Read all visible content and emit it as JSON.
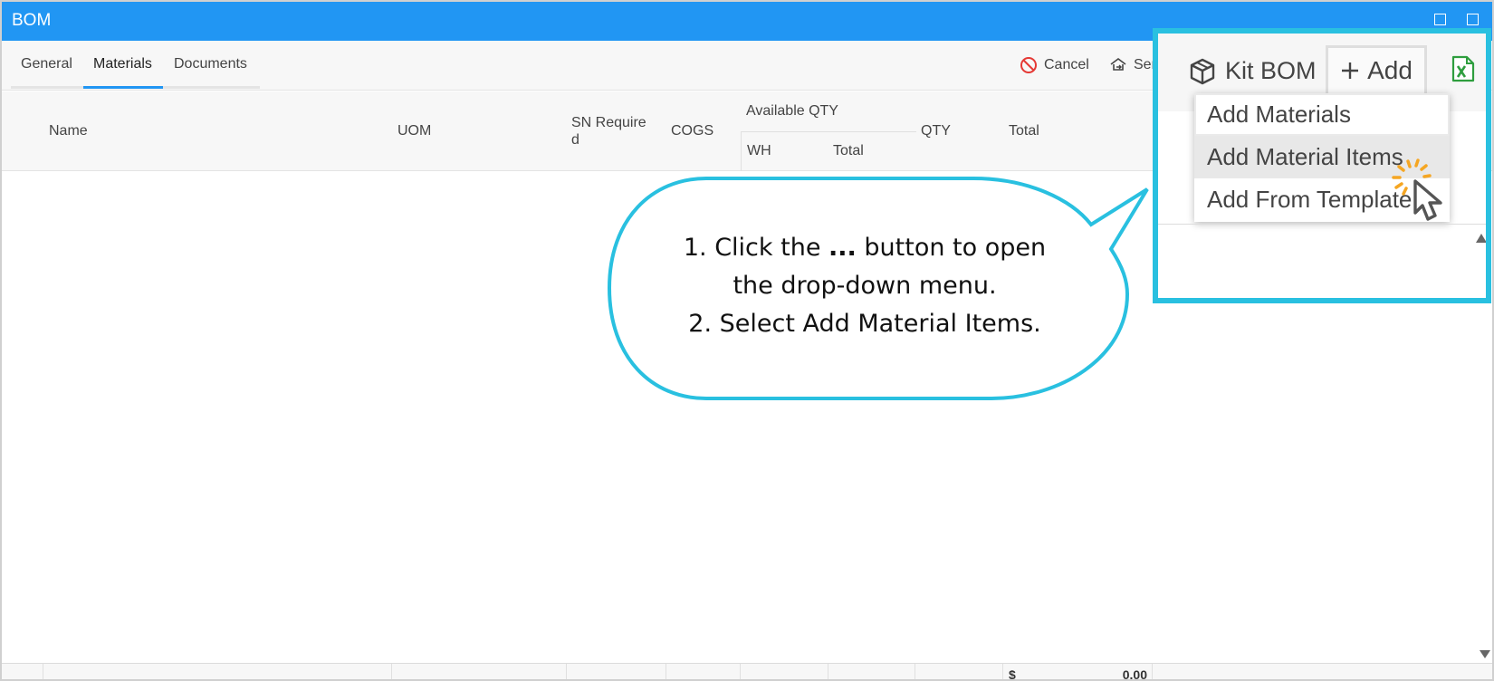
{
  "window": {
    "title": "BOM"
  },
  "tabs": [
    {
      "label": "General"
    },
    {
      "label": "Materials",
      "active": true
    },
    {
      "label": "Documents"
    }
  ],
  "toolbar": {
    "cancel_label": "Cancel",
    "send_label": "Sen"
  },
  "columns": {
    "name": "Name",
    "uom": "UOM",
    "sn_required_line1": "SN Require",
    "sn_required_line2": "d",
    "cogs": "COGS",
    "available_qty": "Available QTY",
    "wh": "WH",
    "avail_total": "Total",
    "qty": "QTY",
    "total": "Total"
  },
  "footer": {
    "currency": "$",
    "total_value": "0.00"
  },
  "callout": {
    "line1_prefix": "1. Click the",
    "line1_bold": "...",
    "line1_suffix": "button to open",
    "line2": "the drop-down menu.",
    "line3": "2. Select Add Material Items."
  },
  "zoom": {
    "kit_bom_label": "Kit BOM",
    "add_label": "Add",
    "menu_items": [
      "Add Materials",
      "Add Material Items",
      "Add From Template"
    ],
    "highlighted_item": "Add Material Items"
  },
  "colors": {
    "titlebar": "#2196f3",
    "accent": "#2196f3",
    "callout_border": "#29c0e0",
    "cancel_icon": "#e53935",
    "excel_icon": "#2e9e3e",
    "click_burst": "#f5a623"
  },
  "icons": [
    "maximize-icon",
    "restore-icon",
    "cancel-icon",
    "send-icon",
    "kit-box-icon",
    "plus-icon",
    "excel-icon",
    "mouse-cursor-icon"
  ]
}
